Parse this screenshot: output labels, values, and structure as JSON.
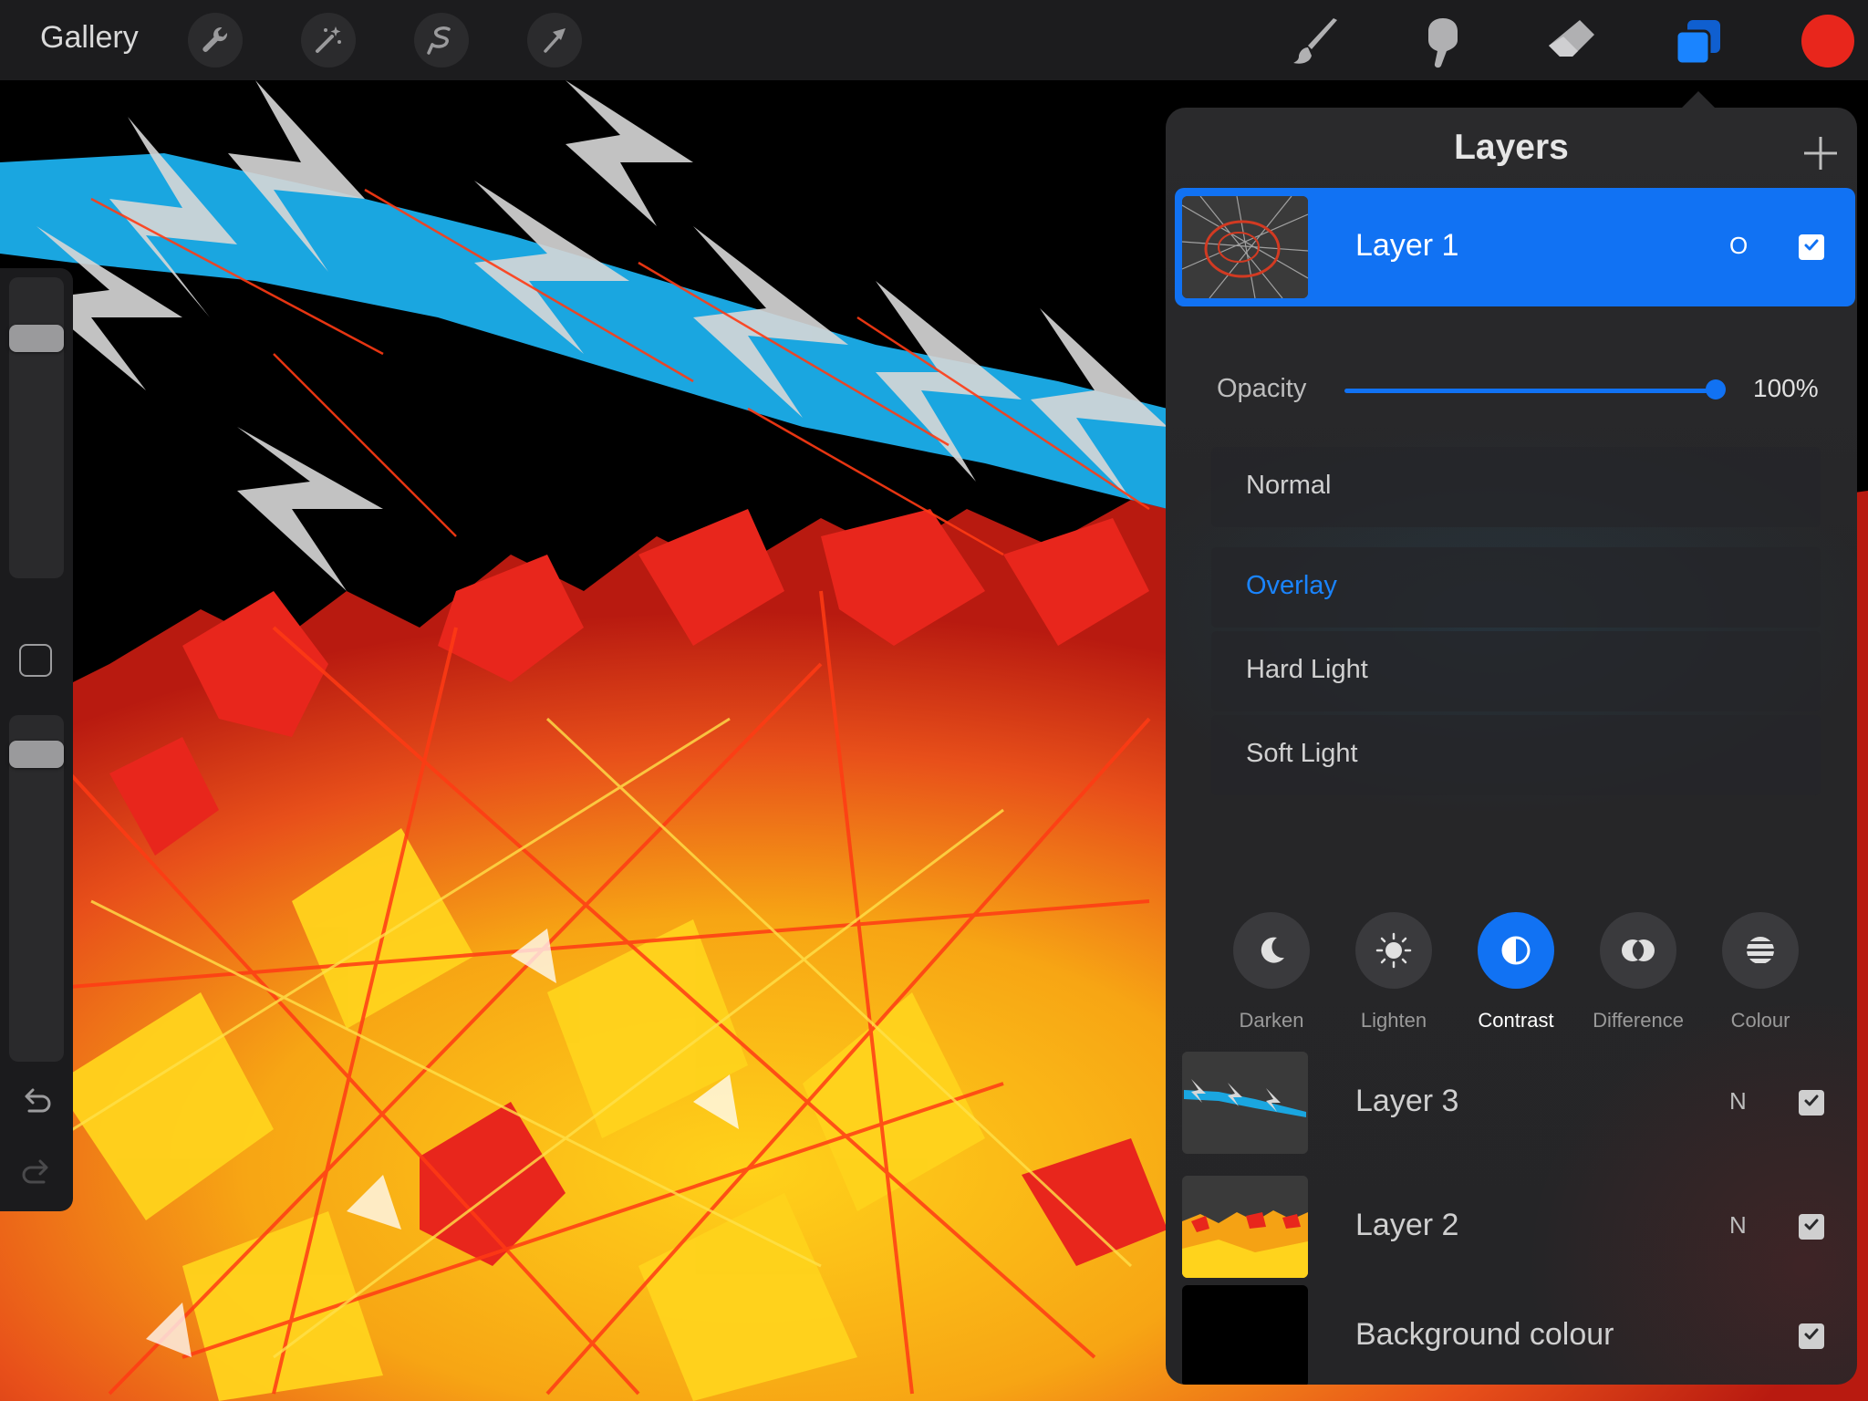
{
  "toolbar": {
    "gallery_label": "Gallery",
    "left_tools": [
      "wrench-icon",
      "magic-wand-icon",
      "selection-icon",
      "transform-arrow-icon"
    ],
    "right_tools": [
      "brush-icon",
      "smudge-icon",
      "eraser-icon",
      "layers-icon"
    ],
    "current_color": "#e8261c",
    "accent_color": "#1172f3"
  },
  "layers_panel": {
    "title": "Layers",
    "selected_layer": {
      "name": "Layer 1",
      "blend_code": "O",
      "visible": true
    },
    "opacity": {
      "label": "Opacity",
      "value": "100%",
      "level": 1.0
    },
    "blend_modes": [
      "Normal",
      "Overlay",
      "Hard Light",
      "Soft Light"
    ],
    "active_blend_mode": "Overlay",
    "categories": [
      {
        "label": "Darken",
        "icon": "moon-icon"
      },
      {
        "label": "Lighten",
        "icon": "sun-icon"
      },
      {
        "label": "Contrast",
        "icon": "half-circle-icon"
      },
      {
        "label": "Difference",
        "icon": "difference-icon"
      },
      {
        "label": "Colour",
        "icon": "stripes-icon"
      }
    ],
    "active_category": "Contrast",
    "other_layers": [
      {
        "name": "Layer 3",
        "blend_code": "N",
        "visible": true
      },
      {
        "name": "Layer 2",
        "blend_code": "N",
        "visible": true
      },
      {
        "name": "Background colour",
        "blend_code": "",
        "visible": true
      }
    ]
  }
}
